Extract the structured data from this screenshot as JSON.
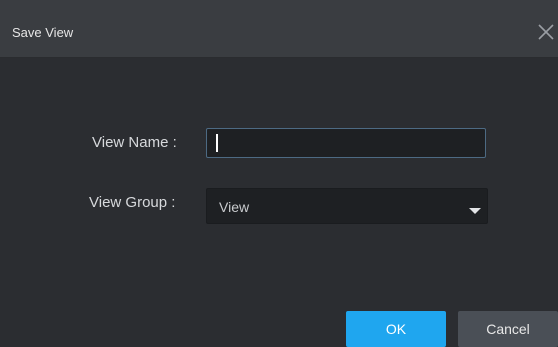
{
  "dialog": {
    "title": "Save View",
    "close_icon": "close-icon"
  },
  "form": {
    "view_name_label": "View Name :",
    "view_name_value": "",
    "view_group_label": "View Group :",
    "view_group_value": "View",
    "dropdown_icon": "chevron-down-icon"
  },
  "footer": {
    "ok_label": "OK",
    "cancel_label": "Cancel"
  },
  "colors": {
    "accent": "#1fa6ef",
    "background": "#2b2d31",
    "titlebar": "#3a3d41"
  }
}
